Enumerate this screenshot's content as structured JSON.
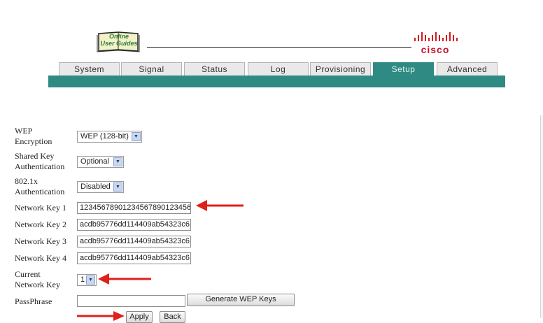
{
  "header": {
    "guide_logo_line1": "Online",
    "guide_logo_line2": "User Guides",
    "brand": "cisco"
  },
  "tabs": [
    {
      "label": "System",
      "active": false
    },
    {
      "label": "Signal",
      "active": false
    },
    {
      "label": "Status",
      "active": false
    },
    {
      "label": "Log",
      "active": false
    },
    {
      "label": "Provisioning",
      "active": false
    },
    {
      "label": "Setup",
      "active": true
    },
    {
      "label": "Advanced",
      "active": false
    }
  ],
  "form": {
    "wep_encryption": {
      "label_l1": "WEP",
      "label_l2": "Encryption",
      "value": "WEP (128-bit)"
    },
    "shared_key_auth": {
      "label_l1": "Shared Key",
      "label_l2": "Authentication",
      "value": "Optional"
    },
    "auth_8021x": {
      "label_l1": "802.1x",
      "label_l2": "Authentication",
      "value": "Disabled"
    },
    "network_keys": [
      {
        "label": "Network Key 1",
        "value": "12345678901234567890123456"
      },
      {
        "label": "Network Key 2",
        "value": "acdb95776dd114409ab54323c6"
      },
      {
        "label": "Network Key 3",
        "value": "acdb95776dd114409ab54323c6"
      },
      {
        "label": "Network Key 4",
        "value": "acdb95776dd114409ab54323c6"
      }
    ],
    "current_network_key": {
      "label_l1": "Current",
      "label_l2": "Network Key",
      "value": "1"
    },
    "passphrase": {
      "label": "PassPhrase",
      "value": ""
    },
    "generate_button": "Generate WEP Keys",
    "apply_button": "Apply",
    "back_button": "Back"
  },
  "colors": {
    "teal": "#2f8a83",
    "annotation_red": "#e0201a",
    "cisco_red": "#c8102e"
  }
}
